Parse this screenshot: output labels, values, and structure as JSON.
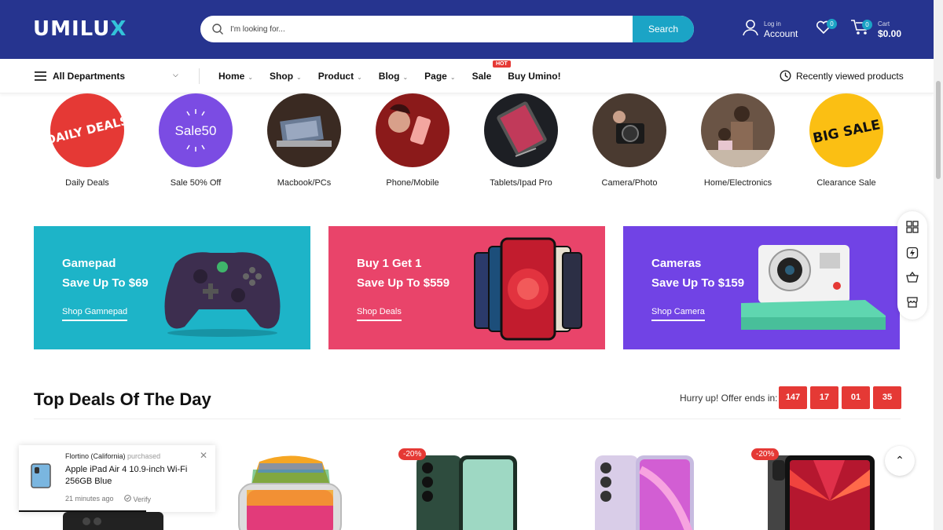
{
  "header": {
    "logo": {
      "part1": "UMILU",
      "part2": "X"
    },
    "search": {
      "placeholder": "I'm looking for...",
      "button": "Search"
    },
    "account": {
      "line1": "Log in",
      "line2": "Account"
    },
    "wishlist_count": "0",
    "cart": {
      "count": "0",
      "label": "Cart",
      "total": "$0.00"
    }
  },
  "nav": {
    "departments": "All Departments",
    "items": [
      {
        "label": "Home",
        "chevron": "⌄"
      },
      {
        "label": "Shop",
        "chevron": "⌄"
      },
      {
        "label": "Product",
        "chevron": "⌄"
      },
      {
        "label": "Blog",
        "chevron": "⌄"
      },
      {
        "label": "Page",
        "chevron": "⌄"
      },
      {
        "label": "Sale",
        "chevron": ""
      },
      {
        "label": "Buy Umino!",
        "chevron": ""
      }
    ],
    "hot_badge": "HOT",
    "recent": "Recently viewed products"
  },
  "categories": [
    {
      "label": "Daily Deals",
      "badge_text": "DAILY DEALS",
      "color": "#e53935"
    },
    {
      "label": "Sale 50% Off",
      "badge_text": "Sale50",
      "color": "#7b4ce3"
    },
    {
      "label": "Macbook/PCs",
      "color": "#3a2a22"
    },
    {
      "label": "Phone/Mobile",
      "color": "#8b1a1a"
    },
    {
      "label": "Tablets/Ipad Pro",
      "color": "#1d1f24"
    },
    {
      "label": "Camera/Photo",
      "color": "#4a3a30"
    },
    {
      "label": "Home/Electronics",
      "color": "#6a5445"
    },
    {
      "label": "Clearance Sale",
      "badge_text": "BIG SALE",
      "color": "#fbbf13"
    }
  ],
  "banners": [
    {
      "title": "Gamepad",
      "subtitle": "Save Up To $69",
      "link": "Shop Gamnepad",
      "color": "#1db4c8"
    },
    {
      "title": "Buy 1 Get 1",
      "subtitle": "Save Up To $559",
      "link": "Shop Deals",
      "color": "#e9446a"
    },
    {
      "title": "Cameras",
      "subtitle": "Save Up To $159",
      "link": "Shop Camera",
      "color": "#7143e5"
    }
  ],
  "deals": {
    "title": "Top Deals Of The Day",
    "hurry": "Hurry up! Offer ends in:",
    "countdown": [
      "147",
      "17",
      "01",
      "35"
    ],
    "discounts": [
      "-20%",
      "-20%"
    ]
  },
  "popup": {
    "who": "Flortino (California)",
    "action": "purchased",
    "product": "Apple iPad Air 4 10.9-inch Wi-Fi 256GB Blue",
    "time": "21 minutes ago",
    "verify": "Verify"
  },
  "side_icons": [
    "grid-icon",
    "bolt-icon",
    "basket-icon",
    "store-icon"
  ],
  "back_to_top": "⌃"
}
